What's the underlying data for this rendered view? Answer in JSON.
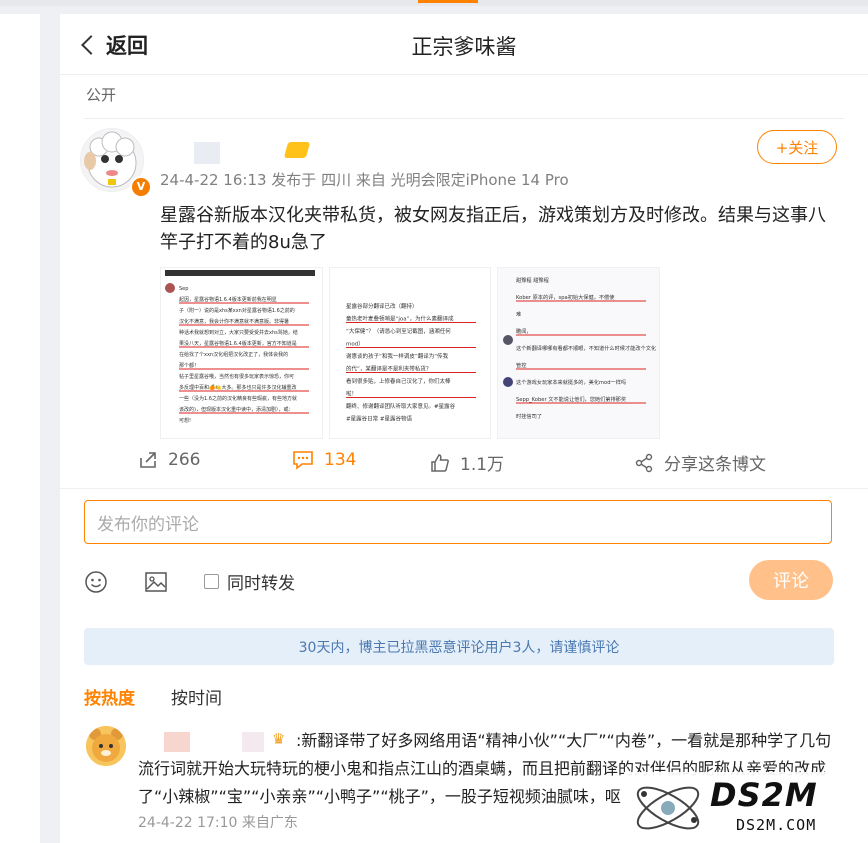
{
  "nav": {
    "back_label": "返回",
    "title": "正宗爹味酱"
  },
  "post": {
    "visibility": "公开",
    "meta": "24-4-22 16:13  发布于 四川  来自 光明会限定iPhone 14 Pro",
    "follow_label": "+关注",
    "verified_badge": "V",
    "text": "星露谷新版本汉化夹带私货，被女网友指正后，游戏策划方及时修改。结果与这事八竿子打不着的8u急了",
    "thumb1": {
      "lines": [
        "Sep",
        "起因，星露谷物语1.6.4版本更新前我在明显",
        "子（附一）说的是xhs某xxn对星露谷物语1.6之前的",
        "汉化不满意，我会计你不满意就不满意版。非得暑",
        "种话术我就想到对立，大家只要受受并去xhs骂她，结",
        "果没八天，星露谷物语1.6.4版本更新，官方不知道是",
        "在给找了个xxn汉化组把汉化改正了，我体会我的",
        "那个都！",
        "帖子里星露谷哦，当然也有很多玩家表示惊恐，你可",
        "多反理中百和🍊🍋大多。那多也只是许多汉化辅重改",
        "一些（没为1.6之前的汉化精良有些瑕疵，有些地方就",
        "该改的)，但现版本汉化重中读中，添清加剧），或：",
        "可想!"
      ]
    },
    "thumb2": {
      "lines": [
        "星露谷部分翻译已改（翻持）",
        "童热老叶麦叠顿哨是“joa”，为什么素翻译成",
        "“大保健”？（请恳心到至记截图，涵湘任何",
        "mod）",
        "谢惠谈的孩子“和我一样调皮”翻译为“传我",
        "的代”，某翻译是不是利夹带私货？",
        "看到很多贴，上修春自己汉化了，你们太棒",
        "啦！",
        "翻终、修谢翻译团队听取大家意见。#星露谷",
        "#星露谷日常 #星露谷物语"
      ]
    },
    "thumb3": {
      "lines": [
        "甜豫程 甜豫程",
        "Kober 原本的评，spa初始大保健，不偿使",
        "难",
        "瞻闻，",
        "这个新翻译哪哪有看都不顺眼，不知道什么时候才能改个文化",
        "管控",
        "这个游戏女玩家本来就挺多的，美化mod一样吗",
        "Sepp_Kober 文不能说让他们，您她们第排那奖",
        "时挂信司了"
      ]
    },
    "stats": {
      "reposts": "266",
      "comments": "134",
      "likes": "1.1万",
      "share_label": "分享这条博文"
    }
  },
  "composer": {
    "placeholder": "发布你的评论",
    "repost_label": "同时转发",
    "submit_label": "评论"
  },
  "notice": "30天内，博主已拉黑恶意评论用户3人，请谨慎评论",
  "sort_tabs": {
    "hot": "按热度",
    "time": "按时间"
  },
  "comment": {
    "text": ":新翻译带了好多网络用语“精神小伙”“大厂”“内卷”，一看就是那种学了几句流行词就开始大玩特玩的梗小鬼和指点江山的酒桌螨，而且把前翻译的对伴侣的昵称从亲爱的改成了“小辣椒”“宝”“小亲亲”“小鸭子”“桃子”，一股子短视频油腻味，呕",
    "meta": "24-4-22 17:10  来自广东"
  },
  "watermark": {
    "big": "DS2M",
    "small": "DS2M.COM"
  },
  "colors": {
    "accent": "#ff8200",
    "notice_bg": "#e4effa",
    "notice_text": "#4a78b0",
    "submit_bg": "#ffc189"
  }
}
